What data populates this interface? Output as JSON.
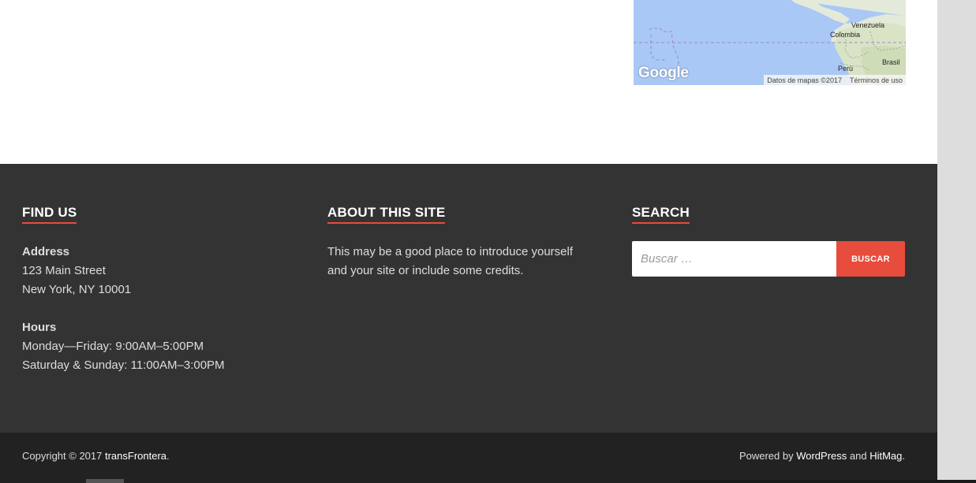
{
  "map": {
    "labels": {
      "venezuela": "Venezuela",
      "colombia": "Colombia",
      "brasil": "Brasil",
      "peru": "Perú"
    },
    "logo": "Google",
    "attribution": "Datos de mapas ©2017",
    "terms": "Términos de uso"
  },
  "footer": {
    "find_us": {
      "title": "FIND US",
      "address_heading": "Address",
      "address_line1": "123 Main Street",
      "address_line2": "New York, NY 10001",
      "hours_heading": "Hours",
      "hours_line1": "Monday—Friday: 9:00AM–5:00PM",
      "hours_line2": "Saturday & Sunday: 11:00AM–3:00PM"
    },
    "about": {
      "title": "ABOUT THIS SITE",
      "line1": "This may be a good place to introduce yourself",
      "line2": "and your site or include some credits."
    },
    "search": {
      "title": "SEARCH",
      "placeholder": "Buscar …",
      "button_label": "BUSCAR"
    }
  },
  "site_info": {
    "copyright_prefix": "Copyright © 2017 ",
    "site_name": "transFrontera",
    "copyright_suffix": ".",
    "powered_prefix": "Powered by ",
    "wordpress": "WordPress",
    "and": " and ",
    "hitmag": "HitMag",
    "powered_suffix": "."
  },
  "colors": {
    "accent": "#e74c3c",
    "footer_bg": "#333333",
    "site_info_bg": "#222222"
  }
}
